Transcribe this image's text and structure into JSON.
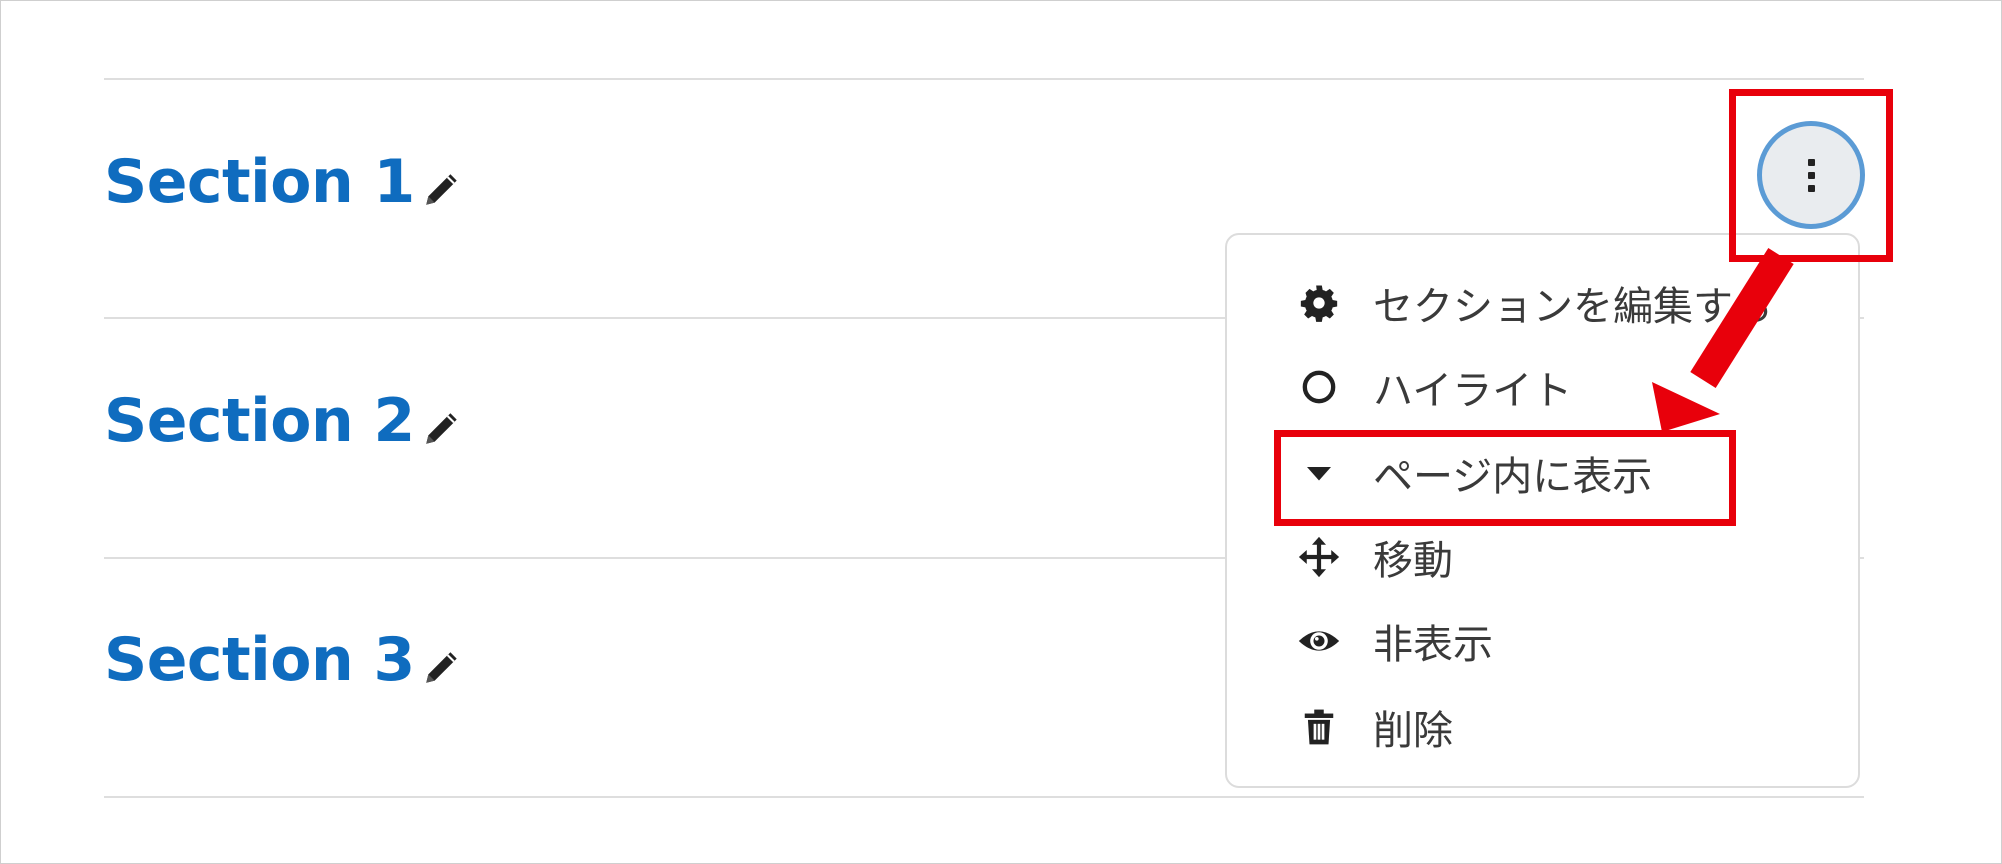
{
  "sections": [
    {
      "title": "Section 1"
    },
    {
      "title": "Section 2"
    },
    {
      "title": "Section 3"
    }
  ],
  "menu": {
    "items": [
      {
        "label": "セクションを編集する",
        "icon": "gear-icon"
      },
      {
        "label": "ハイライト",
        "icon": "circle-outline-icon"
      },
      {
        "label": "ページ内に表示",
        "icon": "caret-down-icon"
      },
      {
        "label": "移動",
        "icon": "move-arrows-icon"
      },
      {
        "label": "非表示",
        "icon": "eye-icon"
      },
      {
        "label": "削除",
        "icon": "trash-icon"
      }
    ]
  },
  "colors": {
    "section_title": "#0f6cbf",
    "annotation_red": "#e8000b",
    "button_ring": "#5b9bd5"
  }
}
